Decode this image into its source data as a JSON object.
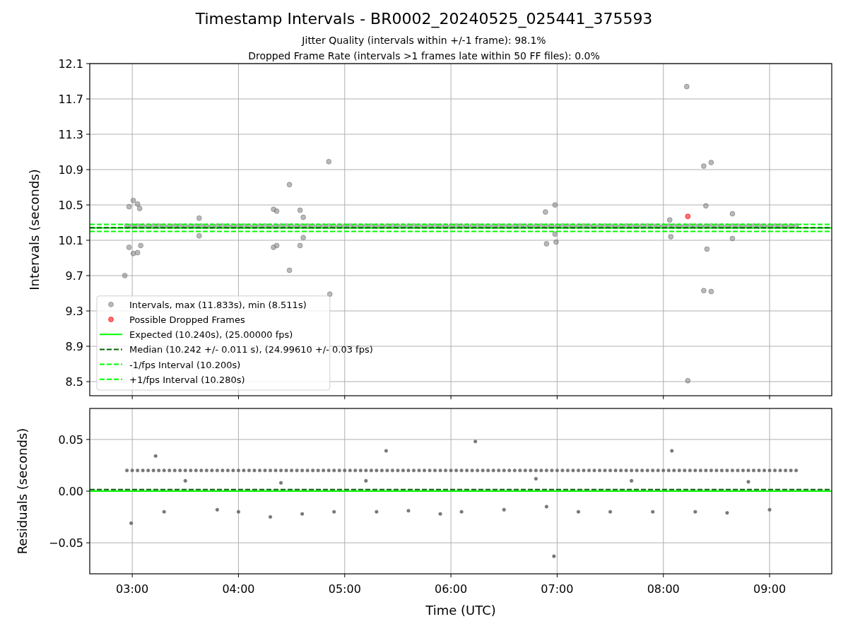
{
  "figure": {
    "title": "Timestamp Intervals - BR0002_20240525_025441_375593"
  },
  "intervals_chart": {
    "chart_data": {
      "type": "scatter",
      "title": [
        "Jitter Quality (intervals within +/-1 frame): 98.1%",
        "Dropped Frame Rate (intervals >1 frames late within 50 FF files): 0.0%"
      ],
      "ylabel": "Intervals (seconds)",
      "xlim": [
        2.6,
        9.585
      ],
      "ylim": [
        8.34,
        12.1
      ],
      "grid": true,
      "yticks": [
        {
          "value": 8.5,
          "label": "8.5"
        },
        {
          "value": 8.9,
          "label": "8.9"
        },
        {
          "value": 9.3,
          "label": "9.3"
        },
        {
          "value": 9.7,
          "label": "9.7"
        },
        {
          "value": 10.1,
          "label": "10.1"
        },
        {
          "value": 10.5,
          "label": "10.5"
        },
        {
          "value": 10.9,
          "label": "10.9"
        },
        {
          "value": 11.3,
          "label": "11.3"
        },
        {
          "value": 11.7,
          "label": "11.7"
        },
        {
          "value": 12.1,
          "label": "12.1"
        }
      ],
      "series": [
        {
          "name": "Intervals, max (11.833s), min (8.511s)",
          "color": "#808080",
          "x": [
            2.95,
            3,
            3.05,
            3.1,
            3.15,
            3.2,
            3.25,
            3.3,
            3.35,
            3.4,
            3.45,
            3.5,
            3.55,
            3.6,
            3.65,
            3.7,
            3.75,
            3.8,
            3.85,
            3.9,
            3.95,
            4,
            4.05,
            4.1,
            4.15,
            4.2,
            4.25,
            4.3,
            4.35,
            4.4,
            4.45,
            4.5,
            4.55,
            4.6,
            4.65,
            4.7,
            4.75,
            4.8,
            4.85,
            4.9,
            4.95,
            5,
            5.05,
            5.1,
            5.15,
            5.2,
            5.25,
            5.3,
            5.35,
            5.4,
            5.45,
            5.5,
            5.55,
            5.6,
            5.65,
            5.7,
            5.75,
            5.8,
            5.85,
            5.9,
            5.95,
            6,
            6.05,
            6.1,
            6.15,
            6.2,
            6.25,
            6.3,
            6.35,
            6.4,
            6.45,
            6.5,
            6.55,
            6.6,
            6.65,
            6.7,
            6.75,
            6.8,
            6.85,
            6.9,
            6.95,
            7,
            7.05,
            7.1,
            7.15,
            7.2,
            7.25,
            7.3,
            7.35,
            7.4,
            7.45,
            7.5,
            7.55,
            7.6,
            7.65,
            7.7,
            7.75,
            7.8,
            7.85,
            7.9,
            7.95,
            8,
            8.05,
            8.1,
            8.15,
            8.2,
            8.25,
            8.3,
            8.35,
            8.4,
            8.45,
            8.5,
            8.55,
            8.6,
            8.65,
            8.7,
            8.75,
            8.8,
            8.85,
            8.9,
            8.95,
            9,
            9.05,
            9.1,
            9.15,
            9.2,
            9.25,
            2.93,
            2.97,
            3.01,
            2.97,
            3.01,
            3.05,
            3.05,
            3.07,
            3.08,
            3.63,
            3.63,
            4.33,
            4.36,
            4.33,
            4.36,
            4.48,
            4.48,
            4.58,
            4.61,
            4.58,
            4.61,
            4.85,
            4.86,
            6.89,
            6.98,
            6.98,
            6.99,
            6.9,
            8.06,
            8.07,
            8.22,
            8.23,
            8.38,
            8.45,
            8.4,
            8.41,
            8.38,
            8.45,
            8.65,
            8.65
          ],
          "values": [
            10.26,
            10.26,
            10.26,
            10.26,
            10.26,
            10.26,
            10.26,
            10.26,
            10.26,
            10.26,
            10.26,
            10.26,
            10.26,
            10.26,
            10.26,
            10.26,
            10.26,
            10.26,
            10.26,
            10.26,
            10.26,
            10.26,
            10.26,
            10.26,
            10.26,
            10.26,
            10.26,
            10.26,
            10.26,
            10.26,
            10.26,
            10.26,
            10.26,
            10.26,
            10.26,
            10.26,
            10.26,
            10.26,
            10.26,
            10.26,
            10.26,
            10.26,
            10.26,
            10.26,
            10.26,
            10.26,
            10.26,
            10.26,
            10.26,
            10.26,
            10.26,
            10.26,
            10.26,
            10.26,
            10.26,
            10.26,
            10.26,
            10.26,
            10.26,
            10.26,
            10.26,
            10.26,
            10.26,
            10.26,
            10.26,
            10.26,
            10.26,
            10.26,
            10.26,
            10.26,
            10.26,
            10.26,
            10.26,
            10.26,
            10.26,
            10.26,
            10.26,
            10.26,
            10.26,
            10.26,
            10.26,
            10.26,
            10.26,
            10.26,
            10.26,
            10.26,
            10.26,
            10.26,
            10.26,
            10.26,
            10.26,
            10.26,
            10.26,
            10.26,
            10.26,
            10.26,
            10.26,
            10.26,
            10.26,
            10.26,
            10.26,
            10.26,
            10.26,
            10.26,
            10.26,
            10.26,
            10.26,
            10.26,
            10.26,
            10.26,
            10.26,
            10.26,
            10.26,
            10.26,
            10.26,
            10.26,
            10.26,
            10.26,
            10.26,
            10.26,
            10.26,
            10.26,
            10.26,
            10.26,
            10.26,
            10.26,
            10.26,
            9.7,
            10.48,
            10.55,
            10.02,
            9.95,
            10.51,
            9.96,
            10.46,
            10.04,
            10.35,
            10.15,
            10.45,
            10.43,
            10.02,
            10.04,
            10.73,
            9.76,
            10.44,
            10.36,
            10.04,
            10.13,
            10.99,
            9.49,
            10.42,
            10.5,
            10.17,
            10.08,
            10.06,
            10.33,
            10.14,
            11.84,
            8.51,
            10.94,
            10.98,
            10.49,
            10.0,
            9.53,
            9.52,
            10.4,
            10.12
          ]
        },
        {
          "name": "Possible Dropped Frames",
          "color": "#ff0000",
          "x": [
            8.23
          ],
          "values": [
            10.37
          ]
        }
      ],
      "legend": "lower left",
      "ref_lines": [
        {
          "axis": "y",
          "value": 10.24,
          "color": "#00ff00",
          "label": "Expected (10.240s), (25.00000 fps)"
        },
        {
          "axis": "y",
          "value": 10.242,
          "color": "#006400",
          "label": "Median (10.242 +/- 0.011 s), (24.99610 +/- 0.03 fps)"
        },
        {
          "axis": "y",
          "value": 10.2,
          "color": "#00ff00",
          "label": "-1/fps Interval (10.200s)"
        },
        {
          "axis": "y",
          "value": 10.28,
          "color": "#00ff00",
          "label": "+1/fps Interval (10.280s)"
        }
      ]
    }
  },
  "residuals_chart": {
    "chart_data": {
      "type": "scatter",
      "xlabel": "Time (UTC)",
      "ylabel": "Residuals (seconds)",
      "xlim": [
        2.6,
        9.585
      ],
      "ylim": [
        -0.08,
        0.08
      ],
      "xticks": [
        {
          "value": 3,
          "label": "03:00"
        },
        {
          "value": 4,
          "label": "04:00"
        },
        {
          "value": 5,
          "label": "05:00"
        },
        {
          "value": 6,
          "label": "06:00"
        },
        {
          "value": 7,
          "label": "07:00"
        },
        {
          "value": 8,
          "label": "08:00"
        },
        {
          "value": 9,
          "label": "09:00"
        }
      ],
      "yticks": [
        {
          "value": -0.05,
          "label": "−0.05"
        },
        {
          "value": 0,
          "label": "0.00"
        },
        {
          "value": 0.05,
          "label": "0.05"
        }
      ],
      "series": [
        {
          "color": "#696969",
          "x": [
            2.95,
            3,
            3.05,
            3.1,
            3.15,
            3.2,
            3.25,
            3.3,
            3.35,
            3.4,
            3.45,
            3.5,
            3.55,
            3.6,
            3.65,
            3.7,
            3.75,
            3.8,
            3.85,
            3.9,
            3.95,
            4,
            4.05,
            4.1,
            4.15,
            4.2,
            4.25,
            4.3,
            4.35,
            4.4,
            4.45,
            4.5,
            4.55,
            4.6,
            4.65,
            4.7,
            4.75,
            4.8,
            4.85,
            4.9,
            4.95,
            5,
            5.05,
            5.1,
            5.15,
            5.2,
            5.25,
            5.3,
            5.35,
            5.4,
            5.45,
            5.5,
            5.55,
            5.6,
            5.65,
            5.7,
            5.75,
            5.8,
            5.85,
            5.9,
            5.95,
            6,
            6.05,
            6.1,
            6.15,
            6.2,
            6.25,
            6.3,
            6.35,
            6.4,
            6.45,
            6.5,
            6.55,
            6.6,
            6.65,
            6.7,
            6.75,
            6.8,
            6.85,
            6.9,
            6.95,
            7,
            7.05,
            7.1,
            7.15,
            7.2,
            7.25,
            7.3,
            7.35,
            7.4,
            7.45,
            7.5,
            7.55,
            7.6,
            7.65,
            7.7,
            7.75,
            7.8,
            7.85,
            7.9,
            7.95,
            8,
            8.05,
            8.1,
            8.15,
            8.2,
            8.25,
            8.3,
            8.35,
            8.4,
            8.45,
            8.5,
            8.55,
            8.6,
            8.65,
            8.7,
            8.75,
            8.8,
            8.85,
            8.9,
            8.95,
            9,
            9.05,
            9.1,
            9.15,
            9.2,
            9.25,
            3.22,
            2.99,
            6.23,
            5.39,
            6.97,
            8.08,
            3.3,
            3.8,
            4.0,
            4.3,
            4.6,
            4.9,
            5.3,
            5.6,
            5.9,
            6.1,
            6.5,
            6.9,
            7.2,
            7.5,
            7.9,
            8.3,
            8.6,
            9.0,
            3.5,
            4.4,
            5.2,
            6.8,
            7.7,
            8.8
          ],
          "values": [
            0.02,
            0.02,
            0.02,
            0.02,
            0.02,
            0.02,
            0.02,
            0.02,
            0.02,
            0.02,
            0.02,
            0.02,
            0.02,
            0.02,
            0.02,
            0.02,
            0.02,
            0.02,
            0.02,
            0.02,
            0.02,
            0.02,
            0.02,
            0.02,
            0.02,
            0.02,
            0.02,
            0.02,
            0.02,
            0.02,
            0.02,
            0.02,
            0.02,
            0.02,
            0.02,
            0.02,
            0.02,
            0.02,
            0.02,
            0.02,
            0.02,
            0.02,
            0.02,
            0.02,
            0.02,
            0.02,
            0.02,
            0.02,
            0.02,
            0.02,
            0.02,
            0.02,
            0.02,
            0.02,
            0.02,
            0.02,
            0.02,
            0.02,
            0.02,
            0.02,
            0.02,
            0.02,
            0.02,
            0.02,
            0.02,
            0.02,
            0.02,
            0.02,
            0.02,
            0.02,
            0.02,
            0.02,
            0.02,
            0.02,
            0.02,
            0.02,
            0.02,
            0.02,
            0.02,
            0.02,
            0.02,
            0.02,
            0.02,
            0.02,
            0.02,
            0.02,
            0.02,
            0.02,
            0.02,
            0.02,
            0.02,
            0.02,
            0.02,
            0.02,
            0.02,
            0.02,
            0.02,
            0.02,
            0.02,
            0.02,
            0.02,
            0.02,
            0.02,
            0.02,
            0.02,
            0.02,
            0.02,
            0.02,
            0.02,
            0.02,
            0.02,
            0.02,
            0.02,
            0.02,
            0.02,
            0.02,
            0.02,
            0.02,
            0.02,
            0.02,
            0.02,
            0.02,
            0.02,
            0.02,
            0.02,
            0.02,
            0.02,
            0.034,
            -0.031,
            0.048,
            0.039,
            -0.063,
            0.039,
            -0.02,
            -0.018,
            -0.02,
            -0.025,
            -0.022,
            -0.02,
            -0.02,
            -0.019,
            -0.022,
            -0.02,
            -0.018,
            -0.015,
            -0.02,
            -0.02,
            -0.02,
            -0.02,
            -0.021,
            -0.018,
            0.01,
            0.008,
            0.01,
            0.012,
            0.01,
            0.009
          ]
        }
      ],
      "grid": true,
      "ref_lines": [
        {
          "axis": "y",
          "value": 0,
          "color": "#00ff00"
        },
        {
          "axis": "y",
          "value": 0.0015,
          "color": "#006400"
        }
      ]
    }
  }
}
